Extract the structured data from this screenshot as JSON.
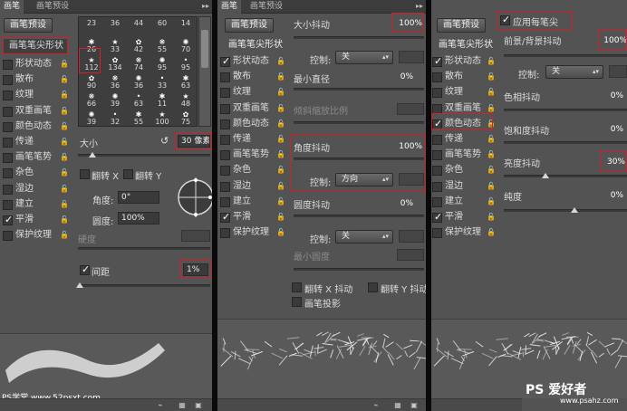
{
  "panel1": {
    "tabs": [
      "画笔",
      "画笔预设"
    ],
    "preset_button": "画笔预设",
    "side_header": "画笔笔尖形状",
    "side_items": [
      {
        "label": "形状动态",
        "checked": false
      },
      {
        "label": "散布",
        "checked": false
      },
      {
        "label": "纹理",
        "checked": false
      },
      {
        "label": "双重画笔",
        "checked": false
      },
      {
        "label": "颜色动态",
        "checked": false
      },
      {
        "label": "传递",
        "checked": false
      },
      {
        "label": "画笔笔势",
        "checked": false
      },
      {
        "label": "杂色",
        "checked": false
      },
      {
        "label": "湿边",
        "checked": false
      },
      {
        "label": "建立",
        "checked": false
      },
      {
        "label": "平滑",
        "checked": true
      },
      {
        "label": "保护纹理",
        "checked": false
      }
    ],
    "brush_tips": [
      [
        "23",
        "36",
        "44",
        "60",
        "14"
      ],
      [
        "26",
        "33",
        "42",
        "55",
        "70"
      ],
      [
        "112",
        "134",
        "74",
        "95",
        "95"
      ],
      [
        "90",
        "36",
        "36",
        "33",
        "63"
      ],
      [
        "66",
        "39",
        "63",
        "11",
        "48"
      ],
      [
        "39",
        "32",
        "55",
        "100",
        "75"
      ]
    ],
    "size_label": "大小",
    "size_value": "30 像素",
    "flip_x_label": "翻转 X",
    "flip_y_label": "翻转 Y",
    "angle_label": "角度:",
    "angle_value": "0°",
    "roundness_label": "圆度:",
    "roundness_value": "100%",
    "hardness_label": "硬度",
    "spacing_label": "间距",
    "spacing_checked": true,
    "spacing_value": "1%",
    "watermark": "PS学堂 www.52psxt.com"
  },
  "panel2": {
    "tabs": [
      "画笔",
      "画笔预设"
    ],
    "preset_button": "画笔预设",
    "side_header": "画笔笔尖形状",
    "side_items": [
      {
        "label": "形状动态",
        "checked": true
      },
      {
        "label": "散布",
        "checked": false
      },
      {
        "label": "纹理",
        "checked": false
      },
      {
        "label": "双重画笔",
        "checked": false
      },
      {
        "label": "颜色动态",
        "checked": false
      },
      {
        "label": "传递",
        "checked": false
      },
      {
        "label": "画笔笔势",
        "checked": false
      },
      {
        "label": "杂色",
        "checked": false
      },
      {
        "label": "湿边",
        "checked": false
      },
      {
        "label": "建立",
        "checked": false
      },
      {
        "label": "平滑",
        "checked": true
      },
      {
        "label": "保护纹理",
        "checked": false
      }
    ],
    "size_jitter_label": "大小抖动",
    "size_jitter_value": "100%",
    "control_label": "控制:",
    "control1_value": "关",
    "min_diameter_label": "最小直径",
    "min_diameter_value": "0%",
    "tilt_scale_label": "倾斜缩放比例",
    "angle_jitter_label": "角度抖动",
    "angle_jitter_value": "100%",
    "control2_value": "方向",
    "roundness_jitter_label": "圆度抖动",
    "roundness_jitter_value": "0%",
    "control3_value": "关",
    "min_roundness_label": "最小圆度",
    "flip_x_jitter_label": "翻转 X 抖动",
    "flip_y_jitter_label": "翻转 Y 抖动",
    "brush_projection_label": "画笔投影"
  },
  "panel3": {
    "preset_button": "画笔预设",
    "side_header": "画笔笔尖形状",
    "side_items": [
      {
        "label": "形状动态",
        "checked": true
      },
      {
        "label": "散布",
        "checked": false
      },
      {
        "label": "纹理",
        "checked": false
      },
      {
        "label": "双重画笔",
        "checked": false
      },
      {
        "label": "颜色动态",
        "checked": true
      },
      {
        "label": "传递",
        "checked": false
      },
      {
        "label": "画笔笔势",
        "checked": false
      },
      {
        "label": "杂色",
        "checked": false
      },
      {
        "label": "湿边",
        "checked": false
      },
      {
        "label": "建立",
        "checked": false
      },
      {
        "label": "平滑",
        "checked": true
      },
      {
        "label": "保护纹理",
        "checked": false
      }
    ],
    "apply_per_tip_label": "应用每笔尖",
    "fg_bg_jitter_label": "前景/背景抖动",
    "fg_bg_jitter_value": "100%",
    "control_label": "控制:",
    "control_value": "关",
    "hue_jitter_label": "色相抖动",
    "hue_jitter_value": "0%",
    "saturation_jitter_label": "饱和度抖动",
    "saturation_jitter_value": "0%",
    "brightness_jitter_label": "亮度抖动",
    "brightness_jitter_value": "30%",
    "purity_label": "纯度",
    "purity_value": "0%",
    "watermark": "PS 爱好者",
    "watermark_url": "www.psahz.com"
  },
  "colors": {
    "panel_bg": "#535353",
    "highlight_red": "#d21f2a"
  }
}
